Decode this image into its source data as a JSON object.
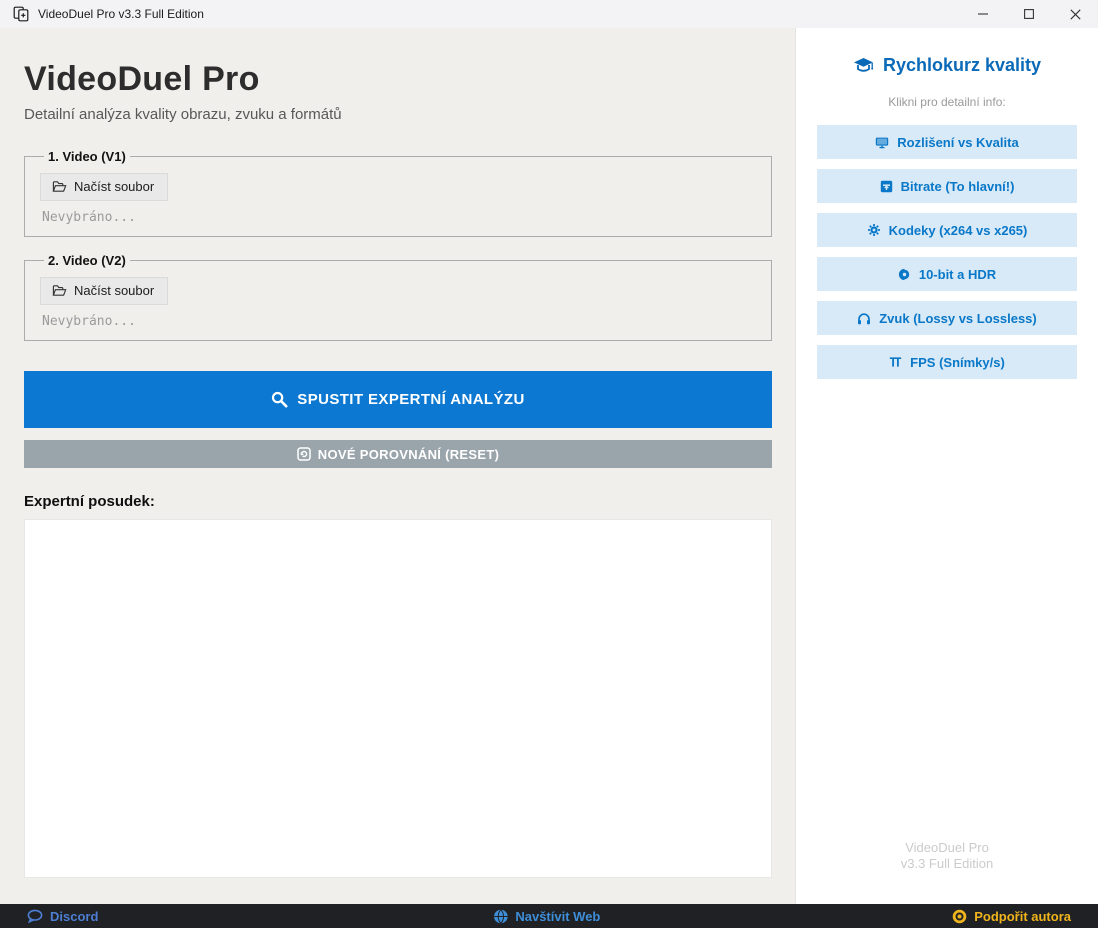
{
  "window": {
    "title": "VideoDuel Pro v3.3 Full Edition",
    "controls": {
      "minimize_icon": "minimize-icon",
      "maximize_icon": "maximize-icon",
      "close_icon": "close-icon"
    },
    "app_icon": "compare-documents-icon"
  },
  "main": {
    "title": "VideoDuel Pro",
    "subtitle": "Detailní analýza kvality obrazu, zvuku a formátů",
    "video1": {
      "legend": "1. Video (V1)",
      "load_button": "Načíst soubor",
      "load_icon": "open-folder-icon",
      "status": "Nevybráno..."
    },
    "video2": {
      "legend": "2. Video (V2)",
      "load_button": "Načíst soubor",
      "load_icon": "open-folder-icon",
      "status": "Nevybráno..."
    },
    "analyze_button": {
      "label": "SPUSTIT EXPERTNÍ ANALÝZU",
      "icon": "search-icon"
    },
    "reset_button": {
      "label": "NOVÉ POROVNÁNÍ (RESET)",
      "icon": "reset-document-icon"
    },
    "report_label": "Expertní posudek:",
    "report_content": ""
  },
  "sidebar": {
    "title": "Rychlokurz kvality",
    "title_icon": "graduation-cap-icon",
    "subtitle": "Klikni pro detailní info:",
    "items": [
      {
        "label": "Rozlišení vs Kvalita",
        "icon": "tv-icon"
      },
      {
        "label": "Bitrate (To hlavní!)",
        "icon": "package-icon"
      },
      {
        "label": "Kodeky (x264 vs x265)",
        "icon": "gear-icon"
      },
      {
        "label": "10-bit a HDR",
        "icon": "color-wheel-icon"
      },
      {
        "label": "Zvuk (Lossy vs Lossless)",
        "icon": "headphones-icon"
      },
      {
        "label": "FPS (Snímky/s)",
        "icon": "film-frames-icon"
      }
    ],
    "footer_line1": "VideoDuel Pro",
    "footer_line2": "v3.3 Full Edition"
  },
  "statusbar": {
    "discord": {
      "label": "Discord",
      "icon": "chat-bubble-icon"
    },
    "website": {
      "label": "Navštívit Web",
      "icon": "globe-icon"
    },
    "donate": {
      "label": "Podpořit autora",
      "icon": "coin-icon"
    }
  },
  "colors": {
    "titlebar_bg": "#f3f3f6",
    "main_bg": "#f0efec",
    "sidebar_bg": "#ffffff",
    "bottombar_bg": "#1f2124",
    "primary_blue": "#0c78d2",
    "reset_gray": "#9aa4ab",
    "sidebar_button_bg": "#d8e9f7",
    "sidebar_button_text": "#0a78c8",
    "sidebar_title_blue": "#0a6ab8",
    "discord_blue": "#4d7ed2",
    "web_blue": "#3e8ed8",
    "donate_gold": "#f0b41c"
  }
}
